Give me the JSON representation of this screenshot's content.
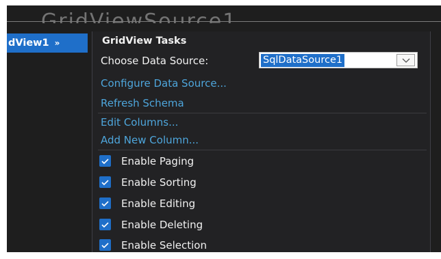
{
  "control_tag": {
    "label": "dView1",
    "chevron": "»"
  },
  "tasks": {
    "title": "GridView Tasks",
    "choose_data_source_label": "Choose Data Source:",
    "data_source_value": "SqlDataSource1",
    "links": [
      {
        "label": "Configure Data Source..."
      },
      {
        "label": "Refresh Schema"
      },
      {
        "label": "Edit Columns..."
      },
      {
        "label": "Add New Column..."
      }
    ],
    "options": [
      {
        "label": "Enable Paging",
        "checked": true
      },
      {
        "label": "Enable Sorting",
        "checked": true
      },
      {
        "label": "Enable Editing",
        "checked": true
      },
      {
        "label": "Enable Deleting",
        "checked": true
      },
      {
        "label": "Enable Selection",
        "checked": true
      }
    ]
  },
  "colors": {
    "accent": "#1f6fc9",
    "link": "#4ea6dc",
    "panel_bg": "#222224",
    "text": "#f1f1f1"
  },
  "icons": {
    "dropdown": "chevron-down-icon",
    "checkbox": "checkmark-icon"
  }
}
